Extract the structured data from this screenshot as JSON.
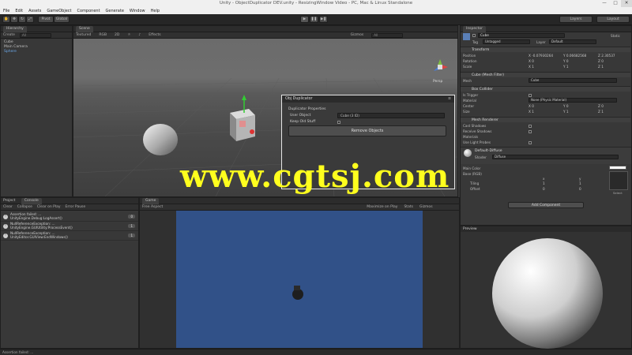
{
  "window": {
    "title": "Unity - ObjectDuplicator DEV.unity - ResizingWindow Video - PC, Mac & Linux Standalone",
    "controls": [
      "—",
      "□",
      "✕"
    ]
  },
  "menu": [
    "File",
    "Edit",
    "Assets",
    "GameObject",
    "Component",
    "Generate",
    "Window",
    "Help"
  ],
  "toolbar": {
    "pivot": "Pivot",
    "global": "Global",
    "layers": "Layers",
    "layout": "Layout",
    "play": "▶",
    "pause": "❚❚",
    "step": "▶❚"
  },
  "hierarchy": {
    "tab": "Hierarchy",
    "create": "Create",
    "search_placeholder": "All",
    "items": [
      "Cube",
      "Main Camera",
      "Sphere"
    ]
  },
  "scene": {
    "tab": "Scene",
    "shading": "Textured",
    "mode": "RGB",
    "view2d": "2D",
    "effects": "Effects",
    "gizmos": "Gizmos",
    "search": "All",
    "persp": "Persp"
  },
  "dialog": {
    "title": "Obj Duplicator",
    "section": "Duplicator Properties",
    "field_label": "User Object",
    "field_value": "Cube (3 ID)",
    "toggle_label": "Keep Old Stuff",
    "button": "Remove Objects"
  },
  "watermark": "www.cgtsj.com",
  "console": {
    "tab_project": "Project",
    "tab": "Console",
    "buttons": [
      "Clear",
      "Collapse",
      "Clear on Play",
      "Error Pause"
    ],
    "entries": [
      {
        "text": "Assertion failed: ...\nUnityEngine.Debug:LogAssert()",
        "count": "0"
      },
      {
        "text": "NullReferenceException: ...\nUnityEngine.GUIUtility:ProcessEvent()",
        "count": "1"
      },
      {
        "text": "NullReferenceException: ...\nUnityEditor.GUIView:EndWindows()",
        "count": "1"
      }
    ]
  },
  "game": {
    "tab": "Game",
    "aspect": "Free Aspect",
    "maximize": "Maximize on Play",
    "stats": "Stats",
    "gizmos": "Gizmos"
  },
  "inspector": {
    "tab": "Inspector",
    "object_name": "Cube",
    "static": "Static",
    "tag_label": "Tag",
    "tag_value": "Untagged",
    "layer_label": "Layer",
    "layer_value": "Default",
    "transform": {
      "title": "Transform",
      "position_label": "Position",
      "rotation_label": "Rotation",
      "scale_label": "Scale",
      "position": [
        "X -0.07930264",
        "Y 0.06682568",
        "Z 2.30537"
      ],
      "rotation": [
        "X 0",
        "Y 0",
        "Z 0"
      ],
      "scale": [
        "X 1",
        "Y 1",
        "Z 1"
      ]
    },
    "mesh_filter": {
      "title": "Cube (Mesh Filter)",
      "mesh_label": "Mesh",
      "mesh_value": "Cube"
    },
    "box_collider": {
      "title": "Box Collider",
      "is_trigger": "Is Trigger",
      "material_label": "Material",
      "material_value": "None (Physic Material)",
      "center_label": "Center",
      "size_label": "Size",
      "center": [
        "X 0",
        "Y 0",
        "Z 0"
      ],
      "size": [
        "X 1",
        "Y 1",
        "Z 1"
      ]
    },
    "mesh_renderer": {
      "title": "Mesh Renderer",
      "cast_shadows": "Cast Shadows",
      "receive_shadows": "Receive Shadows",
      "materials": "Materials",
      "use_light_probes": "Use Light Probes"
    },
    "material": {
      "name": "Default-Diffuse",
      "shader_label": "Shader",
      "shader_value": "Diffuse",
      "main_color": "Main Color",
      "base_rgb": "Base (RGB)",
      "tiling": "Tiling",
      "offset": "Offset",
      "x": "x",
      "y": "y",
      "select": "Select",
      "tiling_x": "1",
      "tiling_y": "1",
      "offset_x": "0",
      "offset_y": "0"
    },
    "add_component": "Add Component"
  },
  "preview": {
    "label": "Preview"
  },
  "statusbar": {
    "text": "Assertion failed: ..."
  }
}
